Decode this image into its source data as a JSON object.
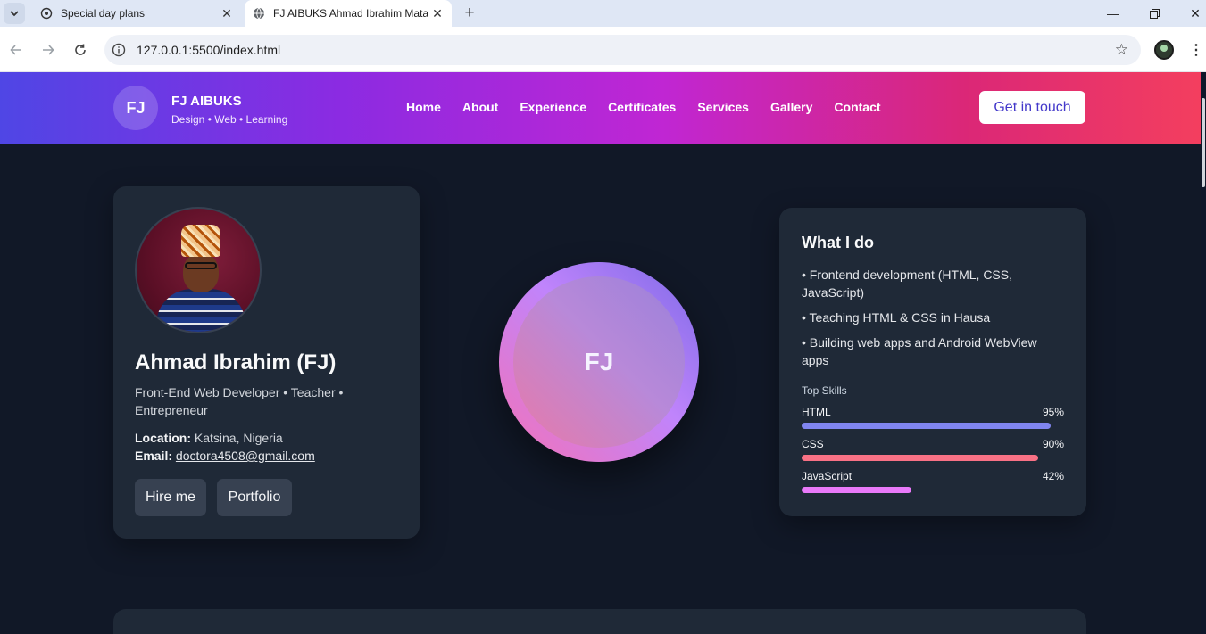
{
  "browser": {
    "tabs": [
      {
        "title": "Special day plans",
        "icon": "openai-icon",
        "active": false
      },
      {
        "title": "FJ AIBUKS Ahmad Ibrahim Mata",
        "icon": "globe-icon",
        "active": true
      }
    ],
    "url": "127.0.0.1:5500/index.html"
  },
  "header": {
    "logo": "FJ",
    "brand_name": "FJ AIBUKS",
    "tagline": "Design • Web • Learning",
    "nav": [
      "Home",
      "About",
      "Experience",
      "Certificates",
      "Services",
      "Gallery",
      "Contact"
    ],
    "cta": "Get in touch"
  },
  "profile": {
    "name": "Ahmad Ibrahim (FJ)",
    "role": "Front-End Web Developer • Teacher • Entrepreneur",
    "location_label": "Location:",
    "location": "Katsina, Nigeria",
    "email_label": "Email:",
    "email": "doctora4508@gmail.com",
    "buttons": {
      "hire": "Hire me",
      "portfolio": "Portfolio"
    }
  },
  "orb": {
    "text": "FJ"
  },
  "what_i_do": {
    "title": "What I do",
    "items": [
      "• Frontend development (HTML, CSS, JavaScript)",
      "• Teaching HTML & CSS in Hausa",
      "• Building web apps and Android WebView apps"
    ],
    "skills_label": "Top Skills",
    "skills": [
      {
        "name": "HTML",
        "percent_label": "95%",
        "value": 95,
        "color": "#8085f0"
      },
      {
        "name": "CSS",
        "percent_label": "90%",
        "value": 90,
        "color": "#f87185"
      },
      {
        "name": "JavaScript",
        "percent_label": "42%",
        "value": 42,
        "color": "#e879f9"
      }
    ]
  },
  "colors": {
    "page_bg": "#111827",
    "card_bg": "#1f2937",
    "cta_text": "#4338ca"
  }
}
